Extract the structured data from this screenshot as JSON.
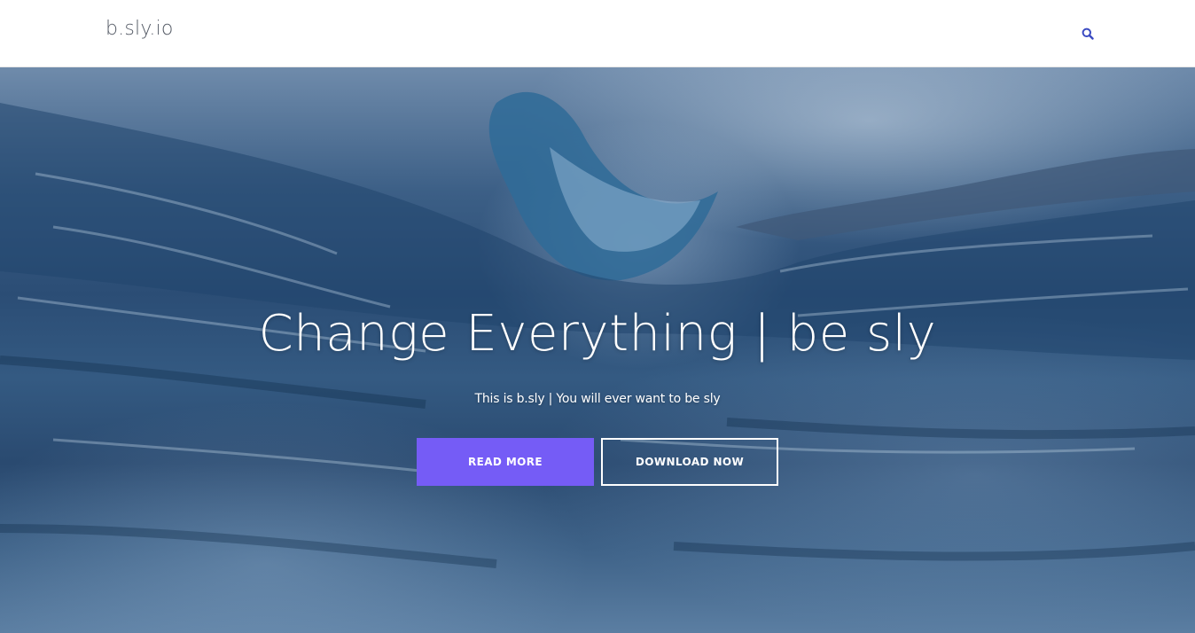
{
  "header": {
    "logo": "b.sly.io",
    "search_icon": "search-icon",
    "accent_color": "#3b4bc2"
  },
  "hero": {
    "title": "Change Everything | be sly",
    "subtitle": "This is b.sly | You will ever want to be sly",
    "buttons": {
      "read_more": "READ MORE",
      "download_now": "DOWNLOAD NOW"
    },
    "button_color": "#755cf6",
    "background": "ocean-wave-photo"
  }
}
